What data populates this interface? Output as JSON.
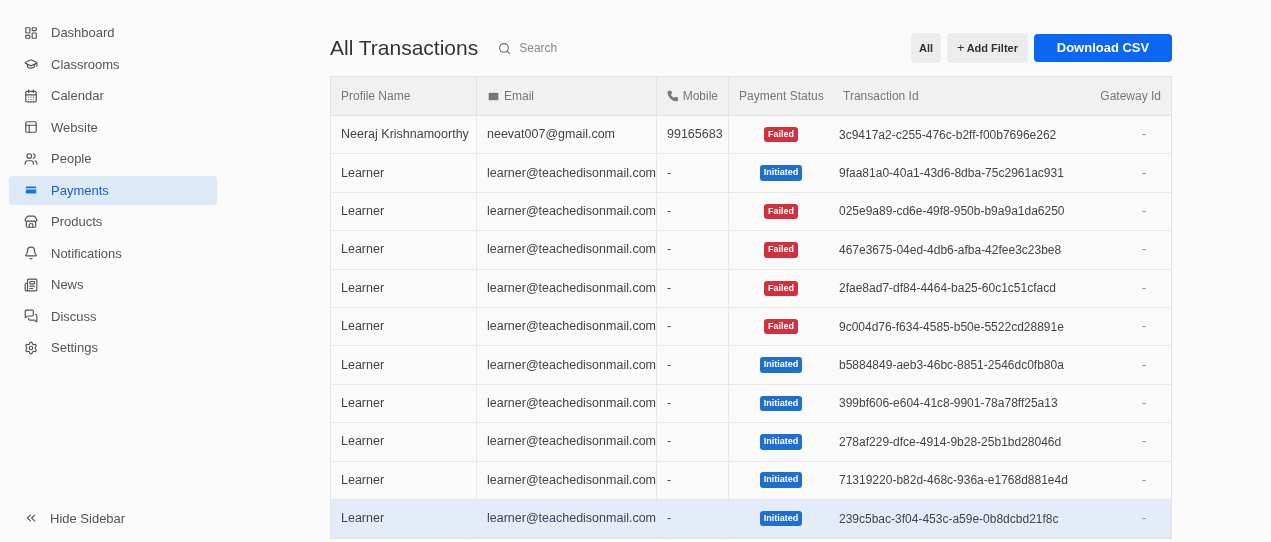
{
  "sidebar": {
    "items": [
      {
        "label": "Dashboard",
        "selected": false
      },
      {
        "label": "Classrooms",
        "selected": false
      },
      {
        "label": "Calendar",
        "selected": false
      },
      {
        "label": "Website",
        "selected": false
      },
      {
        "label": "People",
        "selected": false
      },
      {
        "label": "Payments",
        "selected": true
      },
      {
        "label": "Products",
        "selected": false
      },
      {
        "label": "Notifications",
        "selected": false
      },
      {
        "label": "News",
        "selected": false
      },
      {
        "label": "Discuss",
        "selected": false
      },
      {
        "label": "Settings",
        "selected": false
      }
    ],
    "footer": "Hide Sidebar"
  },
  "header": {
    "title": "All Transactions",
    "search": {
      "placeholder": "Search"
    },
    "filter_all": "All",
    "add_filter": {
      "icon": "+",
      "label": "Add Filter"
    },
    "download": "Download CSV"
  },
  "table": {
    "columns": [
      "Profile Name",
      "Email",
      "Mobile",
      "Payment Status",
      "Transaction Id",
      "Gateway Id"
    ],
    "rows": [
      {
        "name": "Neeraj Krishnamoorthy",
        "email": "neevat007@gmail.com",
        "mobile": "99165683",
        "status": {
          "label": "Failed",
          "kind": "failed"
        },
        "transaction": "3c9417a2-c255-476c-b2ff-f00b7696e262",
        "gateway": "-",
        "selected": false
      },
      {
        "name": "Learner",
        "email": "learner@teachedisonmail.com",
        "mobile": "-",
        "status": {
          "label": "Initiated",
          "kind": "initiated"
        },
        "transaction": "9faa81a0-40a1-43d6-8dba-75c2961ac931",
        "gateway": "-",
        "selected": false
      },
      {
        "name": "Learner",
        "email": "learner@teachedisonmail.com",
        "mobile": "-",
        "status": {
          "label": "Failed",
          "kind": "failed"
        },
        "transaction": "025e9a89-cd6e-49f8-950b-b9a9a1da6250",
        "gateway": "-",
        "selected": false
      },
      {
        "name": "Learner",
        "email": "learner@teachedisonmail.com",
        "mobile": "-",
        "status": {
          "label": "Failed",
          "kind": "failed"
        },
        "transaction": "467e3675-04ed-4db6-afba-42fee3c23be8",
        "gateway": "-",
        "selected": false
      },
      {
        "name": "Learner",
        "email": "learner@teachedisonmail.com",
        "mobile": "-",
        "status": {
          "label": "Failed",
          "kind": "failed"
        },
        "transaction": "2fae8ad7-df84-4464-ba25-60c1c51cfacd",
        "gateway": "-",
        "selected": false
      },
      {
        "name": "Learner",
        "email": "learner@teachedisonmail.com",
        "mobile": "-",
        "status": {
          "label": "Failed",
          "kind": "failed"
        },
        "transaction": "9c004d76-f634-4585-b50e-5522cd28891e",
        "gateway": "-",
        "selected": false
      },
      {
        "name": "Learner",
        "email": "learner@teachedisonmail.com",
        "mobile": "-",
        "status": {
          "label": "Initiated",
          "kind": "initiated"
        },
        "transaction": "b5884849-aeb3-46bc-8851-2546dc0fb80a",
        "gateway": "-",
        "selected": false
      },
      {
        "name": "Learner",
        "email": "learner@teachedisonmail.com",
        "mobile": "-",
        "status": {
          "label": "Initiated",
          "kind": "initiated"
        },
        "transaction": "399bf606-e604-41c8-9901-78a78ff25a13",
        "gateway": "-",
        "selected": false
      },
      {
        "name": "Learner",
        "email": "learner@teachedisonmail.com",
        "mobile": "-",
        "status": {
          "label": "Initiated",
          "kind": "initiated"
        },
        "transaction": "278af229-dfce-4914-9b28-25b1bd28046d",
        "gateway": "-",
        "selected": false
      },
      {
        "name": "Learner",
        "email": "learner@teachedisonmail.com",
        "mobile": "-",
        "status": {
          "label": "Initiated",
          "kind": "initiated"
        },
        "transaction": "71319220-b82d-468c-936a-e1768d881e4d",
        "gateway": "-",
        "selected": false
      },
      {
        "name": "Learner",
        "email": "learner@teachedisonmail.com",
        "mobile": "-",
        "status": {
          "label": "Initiated",
          "kind": "initiated"
        },
        "transaction": "239c5bac-3f04-453c-a59e-0b8dcbd21f8c",
        "gateway": "-",
        "selected": true
      }
    ]
  }
}
